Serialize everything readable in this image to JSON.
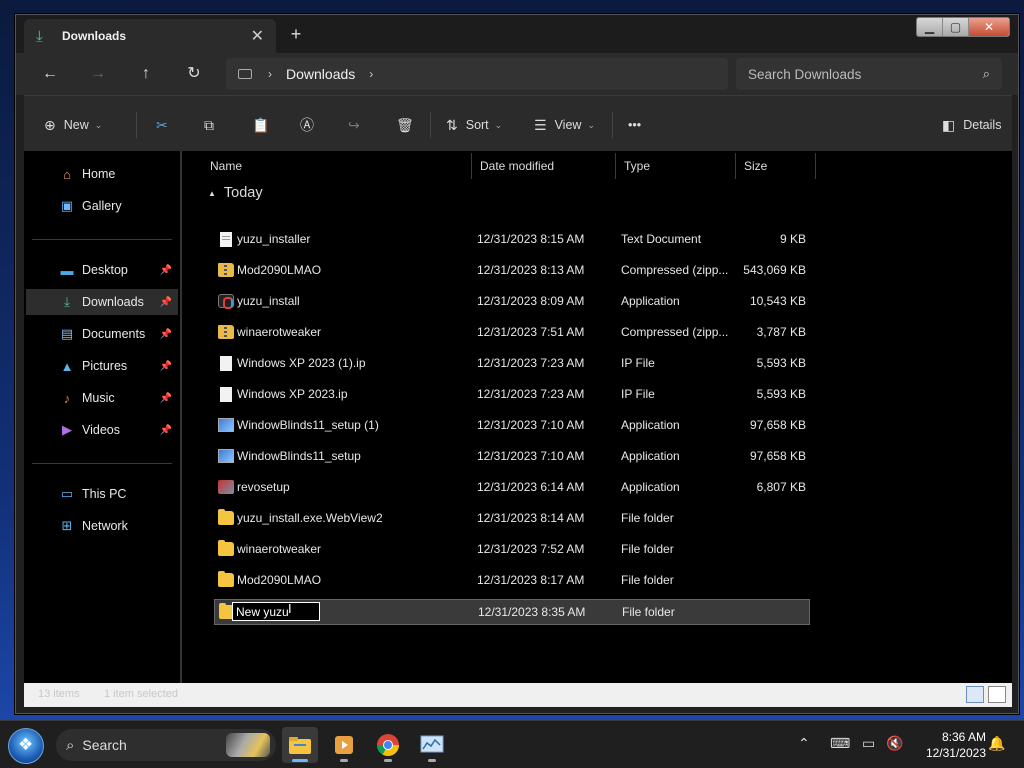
{
  "window": {
    "tab_title": "Downloads",
    "new_tab": "+",
    "controls": {
      "minimize": "▁",
      "maximize": "▢",
      "close": "✕"
    }
  },
  "address": {
    "breadcrumb": [
      "Downloads"
    ],
    "search_placeholder": "Search Downloads"
  },
  "toolbar": {
    "new_label": "New",
    "sort_label": "Sort",
    "view_label": "View",
    "more_label": "•••",
    "details_label": "Details"
  },
  "sidebar": {
    "top": [
      {
        "label": "Home",
        "icon": "home-icon"
      },
      {
        "label": "Gallery",
        "icon": "gallery-icon"
      }
    ],
    "pinned": [
      {
        "label": "Desktop",
        "icon": "desktop-icon"
      },
      {
        "label": "Downloads",
        "icon": "downloads-icon",
        "active": true
      },
      {
        "label": "Documents",
        "icon": "documents-icon"
      },
      {
        "label": "Pictures",
        "icon": "pictures-icon"
      },
      {
        "label": "Music",
        "icon": "music-icon"
      },
      {
        "label": "Videos",
        "icon": "videos-icon"
      }
    ],
    "bottom": [
      {
        "label": "This PC",
        "icon": "this-pc-icon"
      },
      {
        "label": "Network",
        "icon": "network-icon"
      }
    ]
  },
  "columns": {
    "name": "Name",
    "date": "Date modified",
    "type": "Type",
    "size": "Size"
  },
  "group_label": "Today",
  "files": [
    {
      "name": "yuzu_installer",
      "date": "12/31/2023 8:15 AM",
      "type": "Text Document",
      "size": "9 KB",
      "icon": "doc"
    },
    {
      "name": "Mod2090LMAO",
      "date": "12/31/2023 8:13 AM",
      "type": "Compressed (zipp...",
      "size": "543,069 KB",
      "icon": "zip"
    },
    {
      "name": "yuzu_install",
      "date": "12/31/2023 8:09 AM",
      "type": "Application",
      "size": "10,543 KB",
      "icon": "app"
    },
    {
      "name": "winaerotweaker",
      "date": "12/31/2023 7:51 AM",
      "type": "Compressed (zipp...",
      "size": "3,787 KB",
      "icon": "zip"
    },
    {
      "name": "Windows XP 2023 (1).ip",
      "date": "12/31/2023 7:23 AM",
      "type": "IP File",
      "size": "5,593 KB",
      "icon": "page"
    },
    {
      "name": "Windows XP 2023.ip",
      "date": "12/31/2023 7:23 AM",
      "type": "IP File",
      "size": "5,593 KB",
      "icon": "page"
    },
    {
      "name": "WindowBlinds11_setup (1)",
      "date": "12/31/2023 7:10 AM",
      "type": "Application",
      "size": "97,658 KB",
      "icon": "wb"
    },
    {
      "name": "WindowBlinds11_setup",
      "date": "12/31/2023 7:10 AM",
      "type": "Application",
      "size": "97,658 KB",
      "icon": "wb"
    },
    {
      "name": "revosetup",
      "date": "12/31/2023 6:14 AM",
      "type": "Application",
      "size": "6,807 KB",
      "icon": "revo"
    },
    {
      "name": "yuzu_install.exe.WebView2",
      "date": "12/31/2023 8:14 AM",
      "type": "File folder",
      "size": "",
      "icon": "folder"
    },
    {
      "name": "winaerotweaker",
      "date": "12/31/2023 7:52 AM",
      "type": "File folder",
      "size": "",
      "icon": "folder"
    },
    {
      "name": "Mod2090LMAO",
      "date": "12/31/2023 8:17 AM",
      "type": "File folder",
      "size": "",
      "icon": "folder"
    }
  ],
  "renaming_row": {
    "rename_value": "New yuzu",
    "date": "12/31/2023 8:35 AM",
    "type": "File folder",
    "size": ""
  },
  "statusbar": {
    "items_count": "13 items",
    "selected": "1 item selected"
  },
  "taskbar": {
    "search_label": "Search",
    "time": "8:36 AM",
    "date": "12/31/2023"
  },
  "colors": {
    "accent": "#4cc2a0",
    "folder": "#f5c542",
    "selection": "#3a3a3a"
  }
}
